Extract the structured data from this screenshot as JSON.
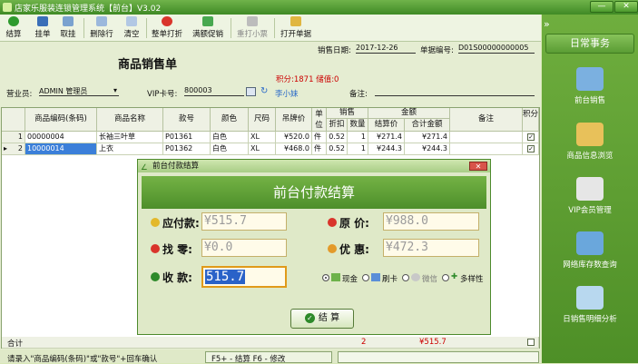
{
  "window": {
    "title": "店家乐服装连锁管理系统【前台】V3.02"
  },
  "toolbar": {
    "buttons": [
      {
        "label": "结算"
      },
      {
        "label": "挂单"
      },
      {
        "label": "取挂"
      },
      {
        "label": "删除行"
      },
      {
        "label": "清空"
      },
      {
        "label": "整单打折"
      },
      {
        "label": "满额促销"
      },
      {
        "label": "重打小票"
      },
      {
        "label": "打开单据"
      }
    ]
  },
  "colors": {
    "accent": "#4e8f27",
    "header_bg": "#74b245",
    "amount_red": "#cc0000"
  },
  "form": {
    "title": "商品销售单",
    "sale_date_label": "销售日期:",
    "sale_date": "2017-12-26",
    "bill_no_label": "单据编号:",
    "bill_no": "D01S00000000005",
    "points_text": "积分:1871 储值:0",
    "clerk_label": "营业员:",
    "clerk": "ADMIN 管理员",
    "vip_label": "VIP卡号:",
    "vip_no": "800003",
    "vip_name": "李小妹",
    "remark_label": "备注:"
  },
  "grid": {
    "headers": [
      "商品编码(条码)",
      "商品名称",
      "款号",
      "颜色",
      "尺码",
      "吊牌价",
      "单位",
      "折扣",
      "数量",
      "结算价",
      "合计金额",
      "备注",
      "积分"
    ],
    "group_sales": "销售",
    "group_amount": "金额",
    "rows": [
      {
        "idx": "1",
        "code": "00000004",
        "name": "长袖三叶草",
        "style": "P01361",
        "color": "白色",
        "size": "XL",
        "price": "¥520.0",
        "unit": "件",
        "disc": "0.52",
        "qty": "1",
        "unit_price": "¥271.4",
        "total": "¥271.4"
      },
      {
        "idx": "2",
        "code": "10000014",
        "name": "上衣",
        "style": "P01362",
        "color": "白色",
        "size": "XL",
        "price": "¥468.0",
        "unit": "件",
        "disc": "0.52",
        "qty": "1",
        "unit_price": "¥244.3",
        "total": "¥244.3"
      }
    ],
    "footer_label": "合计",
    "footer_qty": "2",
    "footer_total": "¥515.7"
  },
  "dialog": {
    "window_title": "前台付款结算",
    "heading": "前台付款结算",
    "payable_label": "应付款:",
    "payable": "¥515.7",
    "original_label": "原  价:",
    "original": "¥988.0",
    "change_label": "找  零:",
    "change": "¥0.0",
    "discount_label": "优  惠:",
    "discount": "¥472.3",
    "received_label": "收  款:",
    "received": "515.7",
    "pay_methods": [
      "现金",
      "刷卡",
      "微信",
      "多样性"
    ],
    "confirm_label": "结  算"
  },
  "bottom": {
    "tip": "请录入\"商品编码(条码)\"或\"款号\"+回车确认",
    "keys": "F5+ - 结算   F6 - 修改"
  },
  "rightpanel": {
    "header": "日常事务",
    "items": [
      {
        "label": "前台销售"
      },
      {
        "label": "商品信息浏览"
      },
      {
        "label": "VIP会员管理"
      },
      {
        "label": "网络库存数查询"
      },
      {
        "label": "日销售明细分析"
      }
    ]
  }
}
